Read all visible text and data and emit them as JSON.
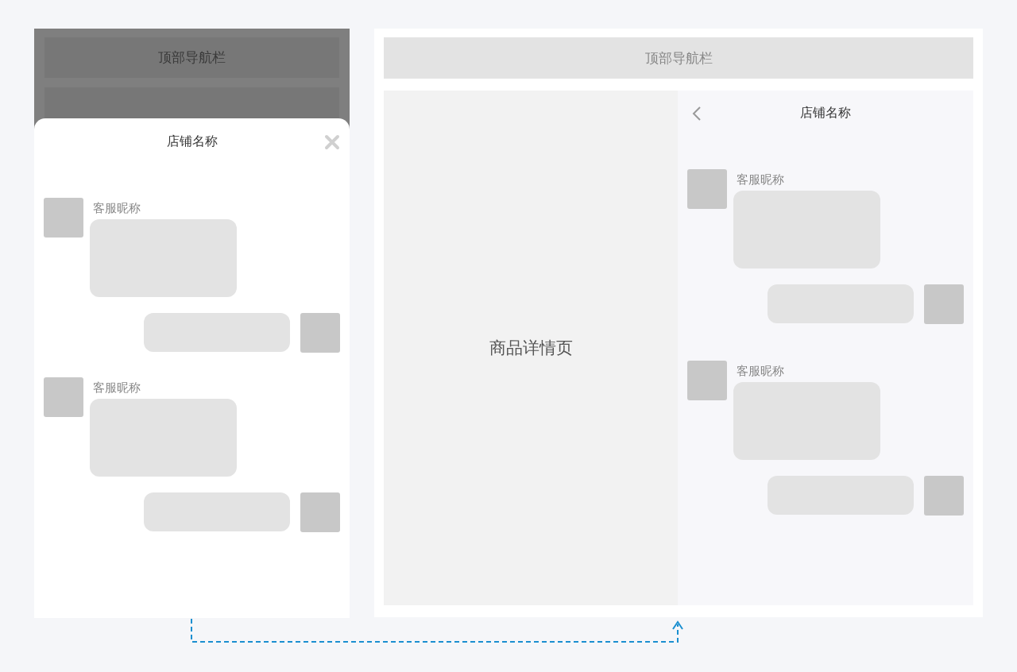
{
  "left_mockup": {
    "nav_bar": "顶部导航栏",
    "sheet": {
      "title": "店铺名称",
      "messages": [
        {
          "kind": "incoming",
          "name": "客服昵称"
        },
        {
          "kind": "outgoing"
        },
        {
          "kind": "incoming",
          "name": "客服昵称"
        },
        {
          "kind": "outgoing"
        }
      ]
    }
  },
  "right_mockup": {
    "nav_bar": "顶部导航栏",
    "detail_page": "商品详情页",
    "chat": {
      "title": "店铺名称",
      "messages": [
        {
          "kind": "incoming",
          "name": "客服昵称"
        },
        {
          "kind": "outgoing"
        },
        {
          "kind": "incoming",
          "name": "客服昵称"
        },
        {
          "kind": "outgoing"
        }
      ]
    }
  }
}
